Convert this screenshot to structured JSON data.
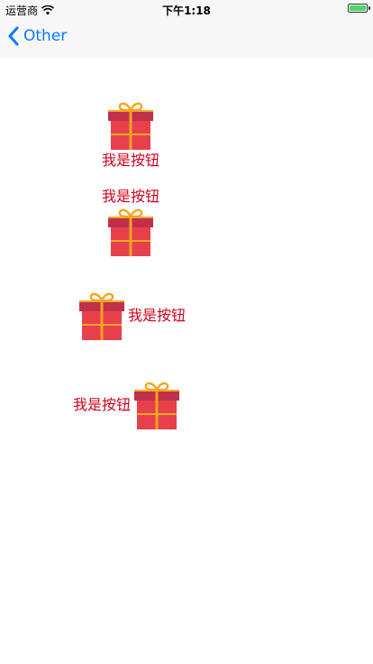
{
  "status_bar": {
    "carrier": "运营商",
    "time": "下午1:18"
  },
  "nav": {
    "back_label": "Other"
  },
  "buttons": [
    {
      "label": "我是按钮",
      "layout": "image-top-title-bottom",
      "icon": "gift-icon"
    },
    {
      "label": "我是按钮",
      "layout": "title-top-image-bottom",
      "icon": "gift-icon"
    },
    {
      "label": "我是按钮",
      "layout": "image-left-title-right",
      "icon": "gift-icon"
    },
    {
      "label": "我是按钮",
      "layout": "title-left-image-right",
      "icon": "gift-icon"
    }
  ],
  "colors": {
    "accent": "#0a7aff",
    "label": "#d0021b",
    "gift_box": "#e8404a",
    "gift_lid": "#c0304a",
    "gift_ribbon": "#f5a623"
  }
}
